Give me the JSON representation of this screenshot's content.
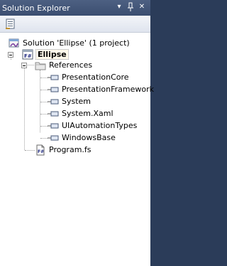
{
  "window": {
    "title": "Solution Explorer",
    "dropdown_glyph": "▾",
    "pin_glyph": "⊓",
    "close_glyph": "✕"
  },
  "toolbar": {
    "properties_icon": "properties-icon"
  },
  "tree": {
    "solution": "Solution 'Ellipse' (1 project)",
    "project": "Ellipse",
    "references": "References",
    "refs": [
      "PresentationCore",
      "PresentationFramework",
      "System",
      "System.Xaml",
      "UIAutomationTypes",
      "WindowsBase"
    ],
    "file": "Program.fs"
  }
}
